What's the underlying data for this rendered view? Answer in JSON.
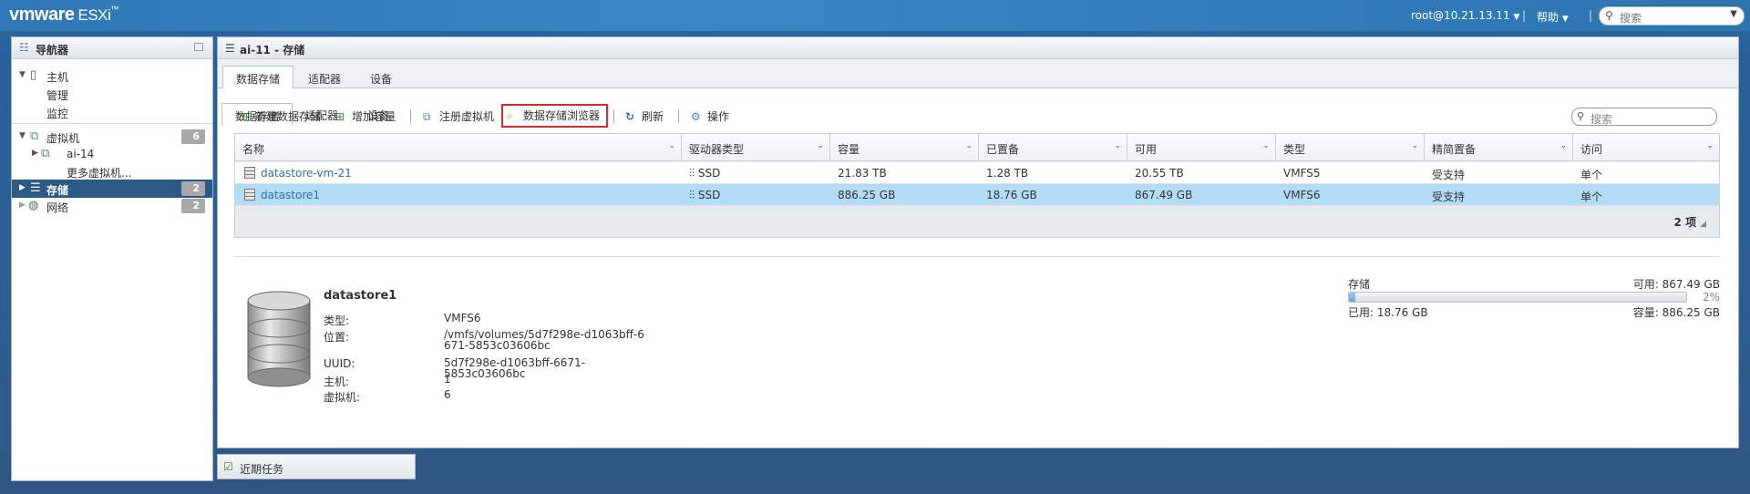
{
  "topbar": {
    "brand": "vmware",
    "product": "ESXi",
    "trademark": "™",
    "user": "root@10.21.13.11",
    "help": "帮助",
    "search_placeholder": "搜索"
  },
  "navigator": {
    "title": "导航器",
    "items": [
      {
        "label": "主机",
        "icon": "host-icon"
      },
      {
        "label": "管理"
      },
      {
        "label": "监控"
      },
      {
        "label": "虚拟机",
        "count": "6",
        "icon": "vm-icon"
      },
      {
        "label": "ai-14",
        "icon": "vm-running-icon"
      },
      {
        "label": "更多虚拟机..."
      },
      {
        "label": "存储",
        "count": "2",
        "icon": "storage-icon"
      },
      {
        "label": "网络",
        "count": "2",
        "icon": "network-icon"
      }
    ]
  },
  "main": {
    "title": "ai-11 - 存储",
    "tabs": [
      "数据存储",
      "适配器",
      "设备"
    ],
    "toolbar": {
      "new_datastore": "新建数据存储",
      "increase_capacity": "增加容量",
      "register_vm": "注册虚拟机",
      "datastore_browser": "数据存储浏览器",
      "refresh": "刷新",
      "actions": "操作"
    },
    "search_placeholder": "搜索",
    "table": {
      "columns": [
        "名称",
        "驱动器类型",
        "容量",
        "已置备",
        "可用",
        "类型",
        "精简置备",
        "访问"
      ],
      "rows": [
        [
          "datastore-vm-21",
          "SSD",
          "21.83 TB",
          "1.28 TB",
          "20.55 TB",
          "VMFS5",
          "受支持",
          "单个"
        ],
        [
          "datastore1",
          "SSD",
          "886.25 GB",
          "18.76 GB",
          "867.49 GB",
          "VMFS6",
          "受支持",
          "单个"
        ]
      ],
      "selected_row": 1,
      "footer": "2 项"
    },
    "detail": {
      "name": "datastore1",
      "fields": [
        {
          "key": "类型:",
          "value": "VMFS6"
        },
        {
          "key": "位置:",
          "value": "/vmfs/volumes/5d7f298e-d1063bff-6671-5853c03606bc"
        },
        {
          "key": "UUID:",
          "value": "5d7f298e-d1063bff-6671-5853c03606bc"
        },
        {
          "key": "主机:",
          "value": "1"
        },
        {
          "key": "虚拟机:",
          "value": "6"
        }
      ],
      "capacity": {
        "label": "存储",
        "free": "可用: 867.49 GB",
        "percent_text": "2%",
        "used_fraction": 0.02,
        "used": "已用: 18.76 GB",
        "total": "容量: 886.25 GB"
      }
    }
  },
  "recent_tasks": "近期任务",
  "colors": {
    "accent": "#2f77b5",
    "selected_nav": "#2c5a86",
    "selected_row": "#b3dcf6",
    "highlight_border": "#d52b2b"
  }
}
